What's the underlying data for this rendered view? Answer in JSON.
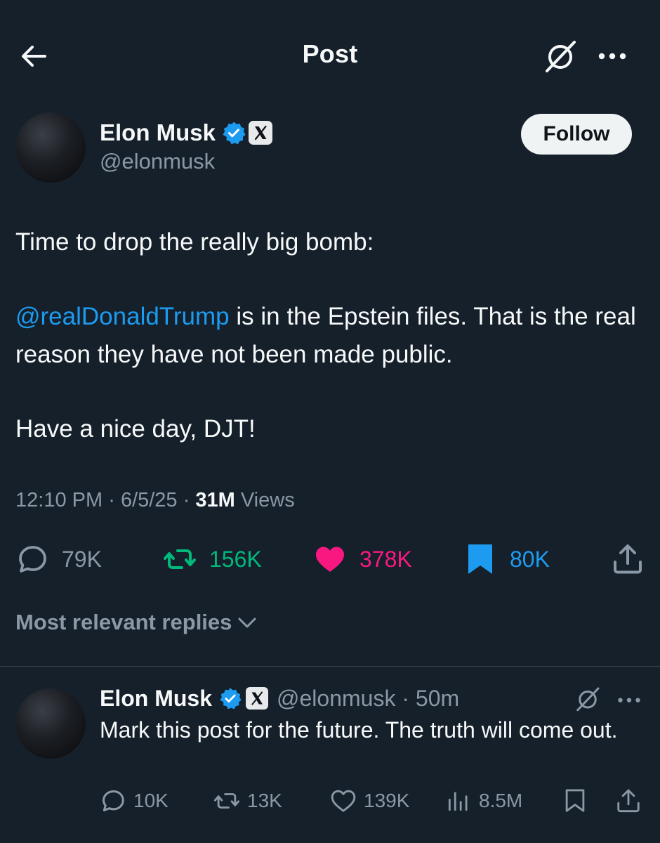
{
  "header": {
    "title": "Post",
    "back_icon": "arrow-left-icon",
    "grok_icon": "grok-icon",
    "more_icon": "more-horizontal-icon"
  },
  "author": {
    "name": "Elon Musk",
    "handle": "@elonmusk",
    "verified_icon": "verified-badge-icon",
    "affiliate_icon": "x-logo-icon",
    "follow_label": "Follow"
  },
  "tweet": {
    "line1": "Time to drop the really big bomb:",
    "mention": "@realDonaldTrump",
    "line2_rest": " is in the Epstein files. That is the real reason they have not been made public.",
    "line3": "Have a nice day, DJT!",
    "time": "12:10 PM",
    "date": "6/5/25",
    "separator": "·",
    "views_count": "31M",
    "views_label": "Views"
  },
  "actions": {
    "replies": "79K",
    "reposts": "156K",
    "likes": "378K",
    "bookmarks": "80K",
    "share_icon": "share-icon"
  },
  "replies_section": {
    "sort_label": "Most relevant replies"
  },
  "reply": {
    "name": "Elon Musk",
    "handle_time": "@elonmusk · 50m",
    "text": "Mark this post for the future. The truth will come out.",
    "replies": "10K",
    "reposts": "13K",
    "likes": "139K",
    "views": "8.5M"
  },
  "colors": {
    "background": "#15202b",
    "accent_blue": "#1d9bf0",
    "repost_green": "#00ba7c",
    "like_pink": "#f91880",
    "muted": "#8b98a5"
  }
}
